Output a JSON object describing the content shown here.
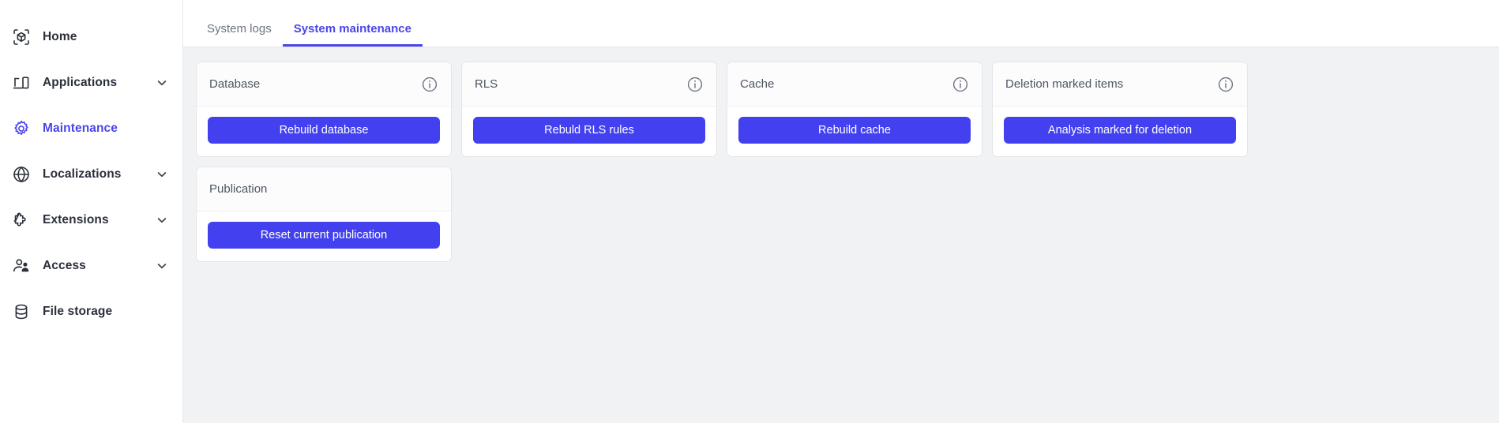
{
  "sidebar": {
    "items": [
      {
        "label": "Home",
        "icon": "cube-scan-icon",
        "active": false,
        "expandable": false
      },
      {
        "label": "Applications",
        "icon": "devices-icon",
        "active": false,
        "expandable": true
      },
      {
        "label": "Maintenance",
        "icon": "gear-icon",
        "active": true,
        "expandable": false
      },
      {
        "label": "Localizations",
        "icon": "globe-icon",
        "active": false,
        "expandable": true
      },
      {
        "label": "Extensions",
        "icon": "puzzle-icon",
        "active": false,
        "expandable": true
      },
      {
        "label": "Access",
        "icon": "user-access-icon",
        "active": false,
        "expandable": true
      },
      {
        "label": "File storage",
        "icon": "database-icon",
        "active": false,
        "expandable": false
      }
    ]
  },
  "topbar": {
    "actions": [
      {
        "name": "notifications-avatar"
      },
      {
        "name": "profile-avatar"
      }
    ]
  },
  "tabs": [
    {
      "label": "System logs",
      "active": false
    },
    {
      "label": "System maintenance",
      "active": true
    }
  ],
  "cards": [
    {
      "title": "Database",
      "button": "Rebuild database",
      "has_info": true,
      "info_icon": "info-circle-icon"
    },
    {
      "title": "RLS",
      "button": "Rebuld RLS rules",
      "has_info": true,
      "info_icon": "info-circle-icon"
    },
    {
      "title": "Cache",
      "button": "Rebuild cache",
      "has_info": true,
      "info_icon": "info-circle-icon"
    },
    {
      "title": "Deletion marked items",
      "button": "Analysis marked for deletion",
      "has_info": true,
      "info_icon": "info-circle-icon"
    },
    {
      "title": "Publication",
      "button": "Reset current publication",
      "has_info": false,
      "info_icon": ""
    }
  ],
  "colors": {
    "accent": "#4b45e8",
    "button": "#4341ef",
    "sidebar_text": "#2b2f3b",
    "muted_text": "#6b7280",
    "page_bg": "#f1f2f4",
    "card_bg": "#ffffff"
  }
}
